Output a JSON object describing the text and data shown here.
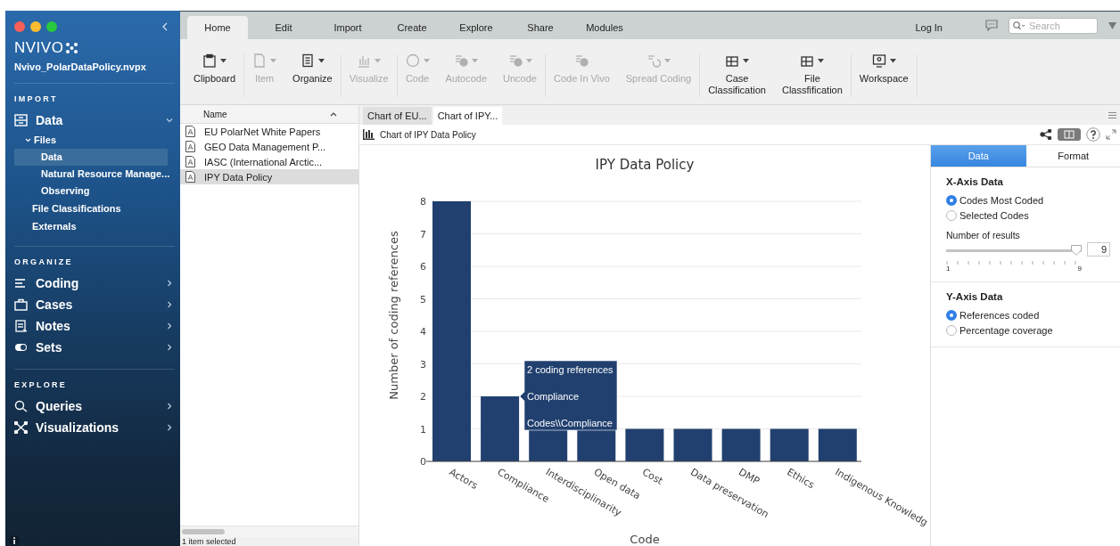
{
  "sidebar": {
    "logo": "NVIVO",
    "project": "Nvivo_PolarDataPolicy.nvpx",
    "sections": [
      {
        "heading": "IMPORT",
        "items": [
          {
            "label": "Data",
            "expanded": true,
            "children": [
              {
                "label": "Files",
                "expanded": true,
                "selected": false,
                "children": [
                  {
                    "label": "Data",
                    "selected": true
                  },
                  {
                    "label": "Natural Resource Manage...",
                    "selected": false
                  },
                  {
                    "label": "Observing",
                    "selected": false
                  }
                ]
              },
              {
                "label": "File Classifications",
                "selected": false
              },
              {
                "label": "Externals",
                "selected": false
              }
            ]
          }
        ]
      },
      {
        "heading": "ORGANIZE",
        "items": [
          {
            "label": "Coding",
            "expanded": false
          },
          {
            "label": "Cases",
            "expanded": false
          },
          {
            "label": "Notes",
            "expanded": false
          },
          {
            "label": "Sets",
            "expanded": false
          }
        ]
      },
      {
        "heading": "EXPLORE",
        "items": [
          {
            "label": "Queries",
            "expanded": false
          },
          {
            "label": "Visualizations",
            "expanded": false
          }
        ]
      }
    ]
  },
  "tabs": [
    {
      "label": "Home",
      "selected": true
    },
    {
      "label": "Edit",
      "selected": false
    },
    {
      "label": "Import",
      "selected": false
    },
    {
      "label": "Create",
      "selected": false
    },
    {
      "label": "Explore",
      "selected": false
    },
    {
      "label": "Share",
      "selected": false
    },
    {
      "label": "Modules",
      "selected": false
    }
  ],
  "login": "Log In",
  "search": {
    "placeholder": "Search"
  },
  "ribbon": {
    "groups": [
      [
        {
          "label": "Clipboard",
          "disabled": false,
          "dropdown": true
        }
      ],
      [
        {
          "label": "Item",
          "disabled": true,
          "dropdown": true
        },
        {
          "label": "Organize",
          "disabled": false,
          "dropdown": true
        }
      ],
      [
        {
          "label": "Visualize",
          "disabled": true,
          "dropdown": true
        }
      ],
      [
        {
          "label": "Code",
          "disabled": true,
          "dropdown": true
        },
        {
          "label": "Autocode",
          "disabled": true,
          "dropdown": true
        },
        {
          "label": "Uncode",
          "disabled": true,
          "dropdown": true
        }
      ],
      [
        {
          "label": "Code In Vivo",
          "disabled": true,
          "dropdown": false
        },
        {
          "label": "Spread Coding",
          "disabled": true,
          "dropdown": true
        }
      ],
      [
        {
          "label": "Case\nClassification",
          "disabled": false,
          "dropdown": true
        },
        {
          "label": "File\nClassfification",
          "disabled": false,
          "dropdown": true
        }
      ],
      [
        {
          "label": "Workspace",
          "disabled": false,
          "dropdown": true
        }
      ]
    ]
  },
  "file_list": {
    "column": "Name",
    "rows": [
      {
        "name": "EU PolarNet White Papers",
        "selected": false
      },
      {
        "name": "GEO Data Management P...",
        "selected": false
      },
      {
        "name": "IASC (International Arctic...",
        "selected": false
      },
      {
        "name": "IPY Data Policy",
        "selected": true
      }
    ],
    "status": "1 item selected"
  },
  "doc_tabs": [
    {
      "label": "Chart of EU...",
      "selected": false
    },
    {
      "label": "Chart of IPY...",
      "selected": true
    }
  ],
  "doc_title": "Chart of IPY Data Policy",
  "chart": {
    "chart_data": {
      "type": "bar",
      "title": "IPY Data Policy",
      "xlabel": "Code",
      "ylabel": "Number of coding references",
      "categories": [
        "Actors",
        "Compliance",
        "Interdisciplinarity",
        "Open data",
        "Cost",
        "Data preservation",
        "DMP",
        "Ethics",
        "Indigenous Knowledg"
      ],
      "values": [
        8,
        2,
        1,
        1,
        1,
        1,
        1,
        1,
        1
      ],
      "yticks": [
        0,
        1,
        2,
        3,
        4,
        5,
        6,
        7,
        8
      ],
      "ylim": [
        0,
        8
      ],
      "grid": true
    },
    "tooltip": [
      "2 coding references",
      "Compliance",
      "Codes\\\\Compliance"
    ]
  },
  "panel": {
    "tabs": [
      {
        "label": "Data",
        "selected": true
      },
      {
        "label": "Format",
        "selected": false
      }
    ],
    "x_axis": {
      "heading": "X-Axis Data",
      "options": [
        {
          "label": "Codes Most Coded",
          "selected": true
        },
        {
          "label": "Selected Codes",
          "selected": false
        }
      ],
      "slider_label": "Number of results",
      "slider": {
        "level": 1,
        "min": "1",
        "max": "9"
      },
      "value": "9"
    },
    "y_axis": {
      "heading": "Y-Axis Data",
      "options": [
        {
          "label": "References coded",
          "selected": true
        },
        {
          "label": "Percentage coverage",
          "selected": false
        }
      ]
    }
  }
}
